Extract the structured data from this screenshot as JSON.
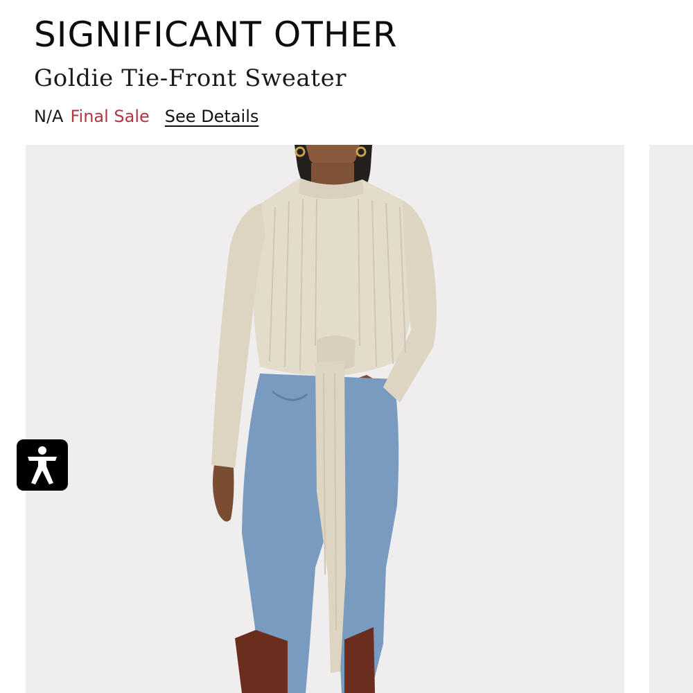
{
  "product": {
    "brand": "SIGNIFICANT OTHER",
    "name": "Goldie Tie-Front Sweater",
    "price": "N/A",
    "sale_label": "Final Sale",
    "details_link": "See Details"
  },
  "gallery": {
    "images": [
      {
        "alt": "Goldie Tie-Front Sweater"
      },
      {
        "alt": ""
      }
    ]
  },
  "accessibility": {
    "icon": "accessibility-person-icon"
  },
  "colors": {
    "sale": "#b0363f",
    "slide_background": "#efedee",
    "sweater": "#e3dccb",
    "denim": "#7a9bc0",
    "boots": "#6b2e1e"
  }
}
